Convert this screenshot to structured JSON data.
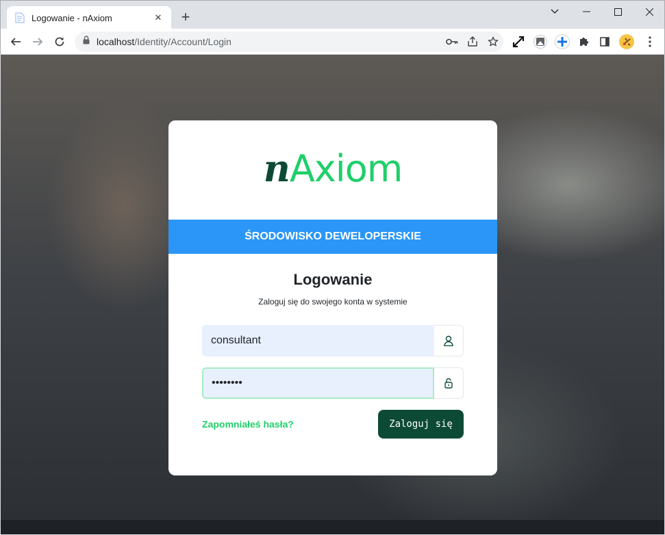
{
  "browser": {
    "tab_title": "Logowanie - nAxiom",
    "tab_close": "✕",
    "new_tab": "+",
    "url_host": "localhost",
    "url_path": "/Identity/Account/Login"
  },
  "page": {
    "logo_n": "n",
    "logo_rest": "Axiom",
    "env_banner": "ŚRODOWISKO DEWELOPERSKIE",
    "heading": "Logowanie",
    "subheading": "Zaloguj się do swojego konta w systemie",
    "username_value": "consultant",
    "password_value": "password",
    "forgot_link": "Zapomniałeś hasła?",
    "login_button": "Zaloguj się"
  },
  "colors": {
    "brand_dark": "#0d4a36",
    "brand_green": "#1fcf6a",
    "banner_blue": "#2b96f7"
  }
}
